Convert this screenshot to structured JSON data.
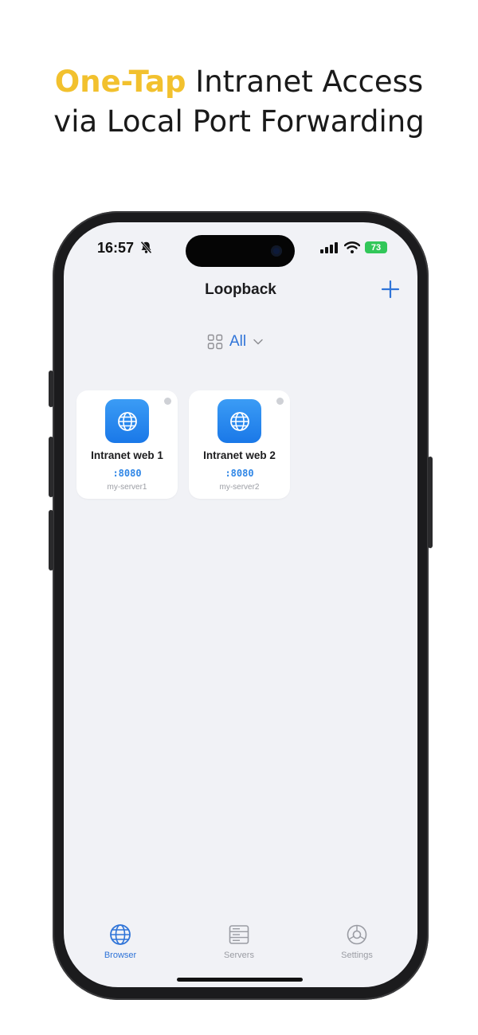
{
  "headline": {
    "accent": "One-Tap",
    "line1_rest": " Intranet Access",
    "line2": "via Local Port Forwarding"
  },
  "status_bar": {
    "time": "16:57",
    "icons": [
      "bell-slash-icon",
      "cellular-signal-icon",
      "wifi-icon",
      "battery-icon"
    ],
    "battery_level": "73"
  },
  "nav": {
    "title": "Loopback",
    "add_icon": "plus-icon"
  },
  "filter": {
    "icon": "grid-icon",
    "label": "All",
    "chevron": "chevron-down-icon"
  },
  "cards": [
    {
      "name": "Intranet web 1",
      "port": ":8080",
      "server": "my-server1",
      "icon": "globe-icon"
    },
    {
      "name": "Intranet web 2",
      "port": ":8080",
      "server": "my-server2",
      "icon": "globe-icon"
    }
  ],
  "tabs": [
    {
      "label": "Browser",
      "icon": "globe-icon",
      "active": true
    },
    {
      "label": "Servers",
      "icon": "server-icon",
      "active": false
    },
    {
      "label": "Settings",
      "icon": "gear-icon",
      "active": false
    }
  ],
  "colors": {
    "accent": "#f2c12e",
    "primary": "#2f74d8",
    "screen_bg": "#f1f2f6",
    "inactive": "#9a9ca3",
    "battery": "#32c759"
  }
}
